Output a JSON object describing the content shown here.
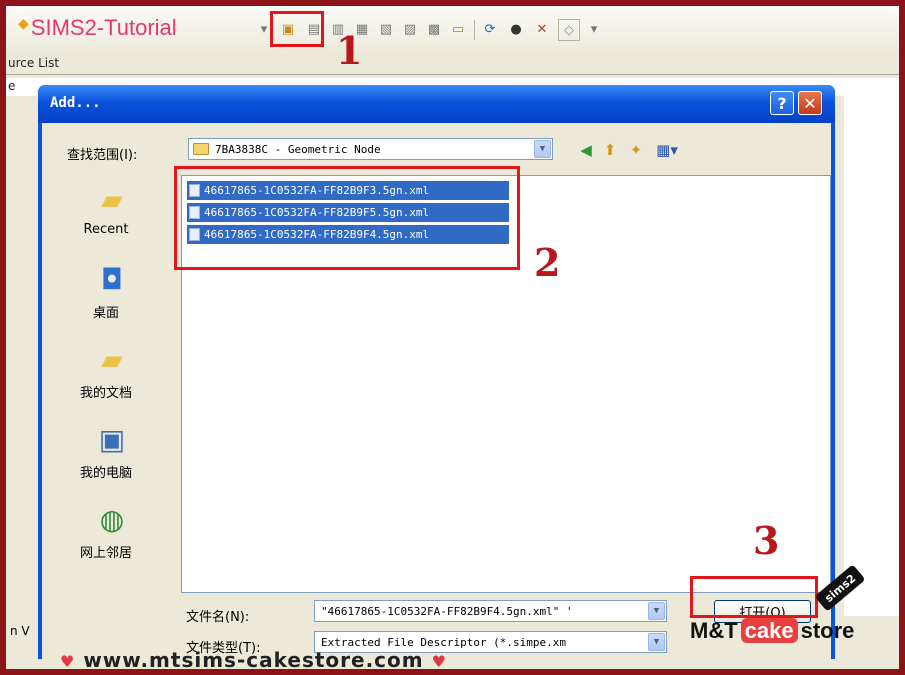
{
  "app": {
    "toolbar_title": "SIMS2-Tutorial",
    "resource_list_label": "urce List",
    "column_label": "e",
    "lower_label": "n V"
  },
  "dialog": {
    "title": "Add...",
    "help_glyph": "?",
    "close_glyph": "✕",
    "look_in_label": "查找范围(I):",
    "look_in_value": "7BA3838C - Geometric Node"
  },
  "places": [
    {
      "label": "Recent",
      "icon": "recent-folder-icon"
    },
    {
      "label": "桌面",
      "icon": "desktop-icon"
    },
    {
      "label": "我的文档",
      "icon": "my-documents-icon"
    },
    {
      "label": "我的电脑",
      "icon": "my-computer-icon"
    },
    {
      "label": "网上邻居",
      "icon": "network-icon"
    }
  ],
  "files": [
    "46617865-1C0532FA-FF82B9F3.5gn.xml",
    "46617865-1C0532FA-FF82B9F5.5gn.xml",
    "46617865-1C0532FA-FF82B9F4.5gn.xml"
  ],
  "filename": {
    "label": "文件名(N):",
    "value": "\"46617865-1C0532FA-FF82B9F4.5gn.xml\" '"
  },
  "filetype": {
    "label": "文件类型(T):",
    "value": "Extracted File Descriptor (*.simpe.xm"
  },
  "open_button": "打开(O)",
  "steps": [
    "1",
    "2",
    "3"
  ],
  "watermark": {
    "text": "www.mtsims-cakestore.com",
    "logo_left": "M&T",
    "logo_cake": "cake",
    "logo_right": "store",
    "badge": "sims2"
  },
  "colors": {
    "frame": "#8c1418",
    "annotation_red": "#e3161c",
    "xp_blue": "#0a54e2",
    "selection": "#316ac5"
  }
}
